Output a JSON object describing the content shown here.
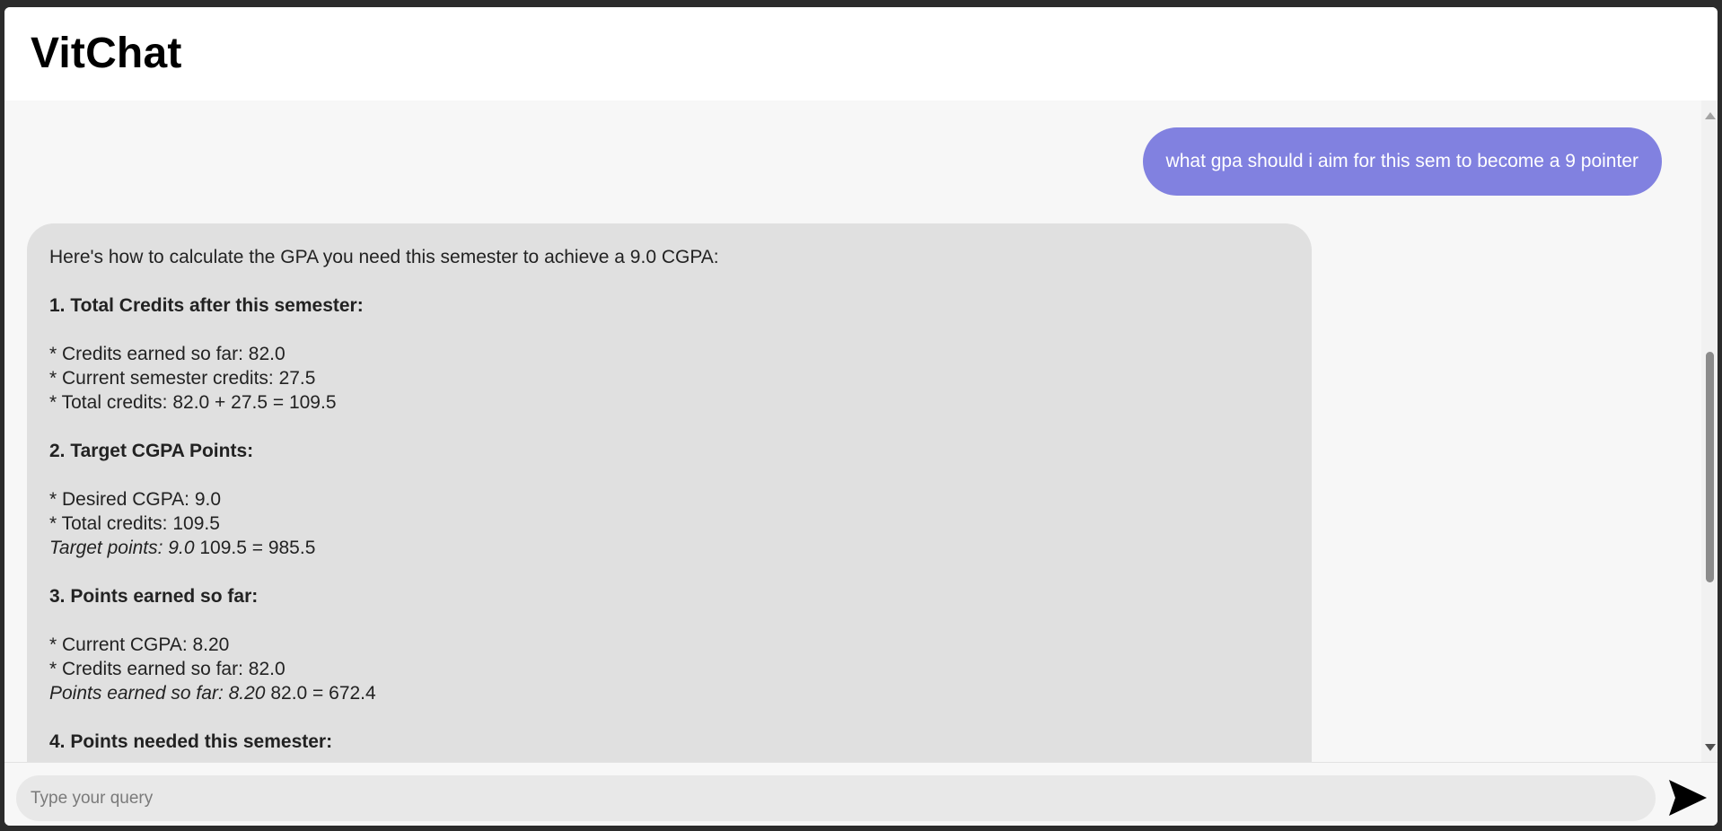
{
  "app": {
    "title": "VitChat"
  },
  "chat": {
    "user_message": "what gpa should i aim for this sem to become a 9 pointer",
    "bot_message": {
      "intro": "Here's how to calculate the GPA you need this semester to achieve a 9.0 CGPA:",
      "s1_heading": "1. Total Credits after this semester:",
      "s1_line1": "* Credits earned so far: 82.0",
      "s1_line2": "* Current semester credits: 27.5",
      "s1_line3": "* Total credits: 82.0 + 27.5 = 109.5",
      "s2_heading": "2. Target CGPA Points:",
      "s2_line1": "* Desired CGPA: 9.0",
      "s2_line2": "* Total credits: 109.5",
      "s2_line3_italic": "Target points: 9.0",
      "s2_line3_rest": " 109.5 = 985.5",
      "s3_heading": "3. Points earned so far:",
      "s3_line1": "* Current CGPA: 8.20",
      "s3_line2": "* Credits earned so far: 82.0",
      "s3_line3_italic": "Points earned so far: 8.20",
      "s3_line3_rest": " 82.0 = 672.4",
      "s4_heading": "4. Points needed this semester:"
    }
  },
  "composer": {
    "placeholder": "Type your query",
    "value": "",
    "send_icon": "send-arrow-icon"
  },
  "colors": {
    "user_bubble": "#8181e0",
    "bot_bubble": "#e0e0e0",
    "chat_background": "#f7f7f7"
  }
}
